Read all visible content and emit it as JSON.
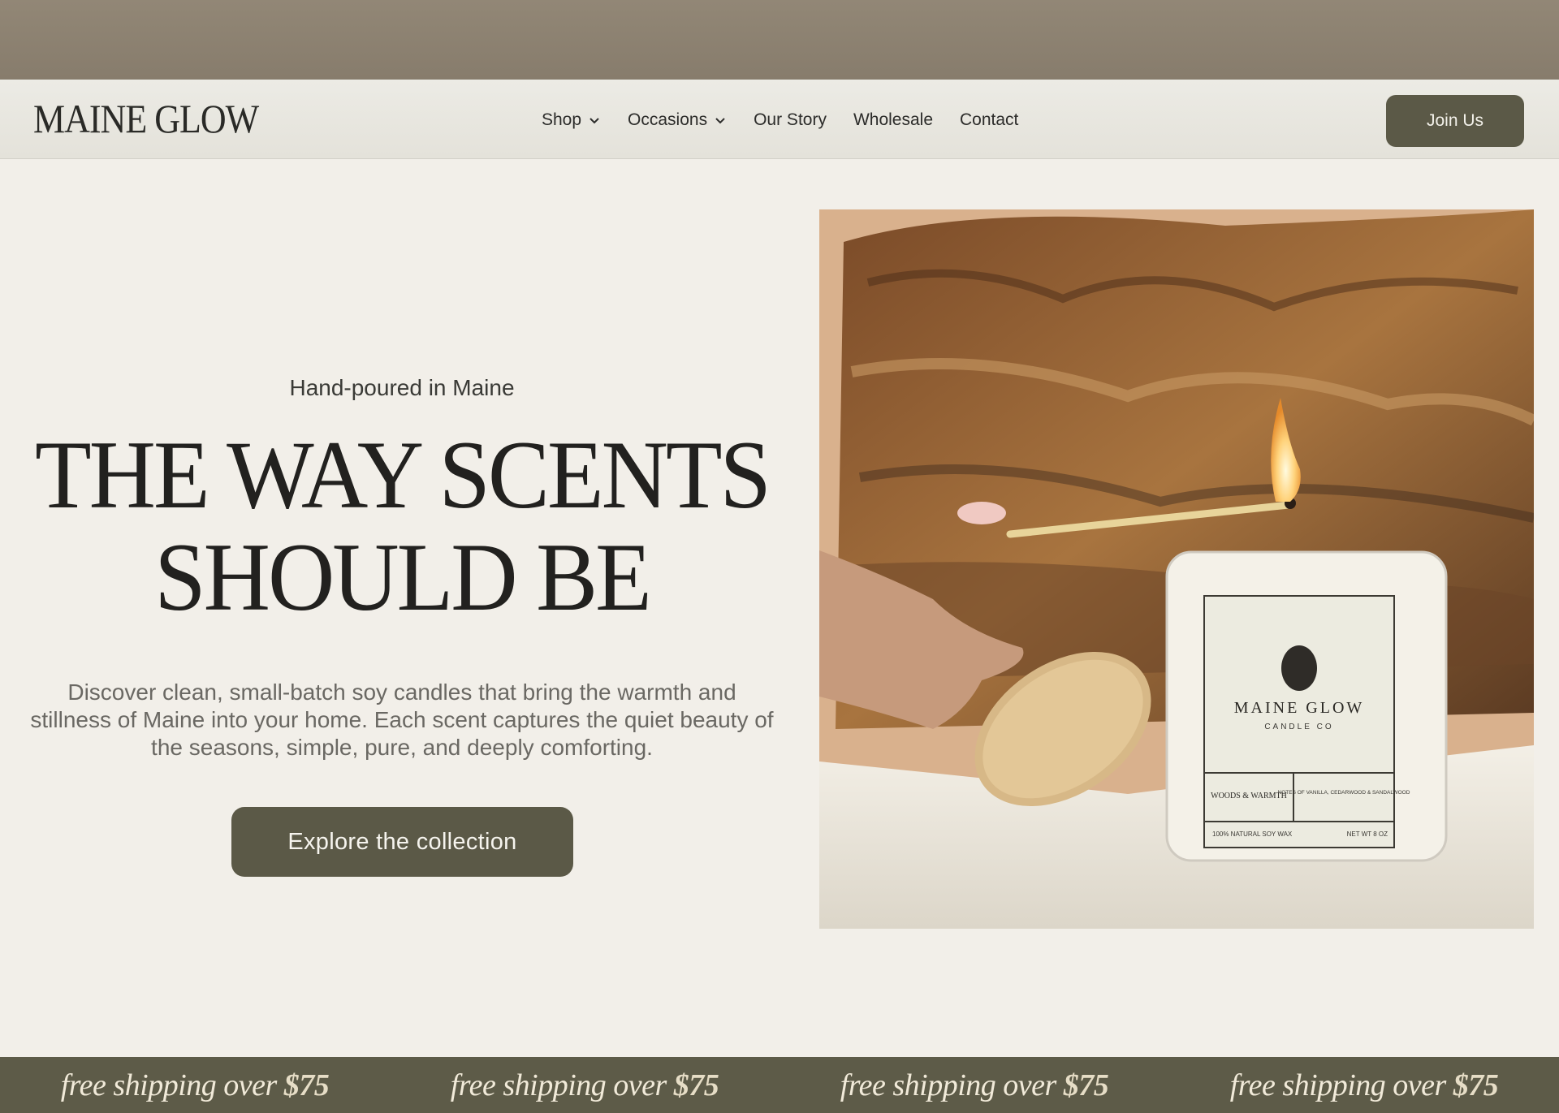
{
  "header": {
    "logo": "MAINE GLOW",
    "nav": [
      {
        "label": "Shop",
        "dropdown": true
      },
      {
        "label": "Occasions",
        "dropdown": true
      },
      {
        "label": "Our Story",
        "dropdown": false
      },
      {
        "label": "Wholesale",
        "dropdown": false
      },
      {
        "label": "Contact",
        "dropdown": false
      }
    ],
    "cta": "Join Us"
  },
  "hero": {
    "eyebrow": "Hand-poured in Maine",
    "headline_line1": "THE WAY SCENTS",
    "headline_line2": "SHOULD BE",
    "body": "Discover clean, small-batch soy candles that bring the warmth and stillness of Maine into your home. Each scent captures the quiet beauty of the seasons, simple, pure, and deeply comforting.",
    "cta": "Explore the collection"
  },
  "product_image": {
    "label_brand": "MAINE GLOW",
    "label_sub": "CANDLE CO",
    "label_scent": "WOODS & WARMTH",
    "label_notes": "NOTES OF VANILLA, CEDARWOOD & SANDALWOOD",
    "label_wax": "100% NATURAL SOY WAX",
    "label_weight": "NET WT 8 OZ"
  },
  "promo_bar": {
    "text": "free shipping over",
    "amount": "$75"
  },
  "colors": {
    "accent": "#5b5947",
    "background": "#f2efe9",
    "top_strip": "#8c8170"
  }
}
